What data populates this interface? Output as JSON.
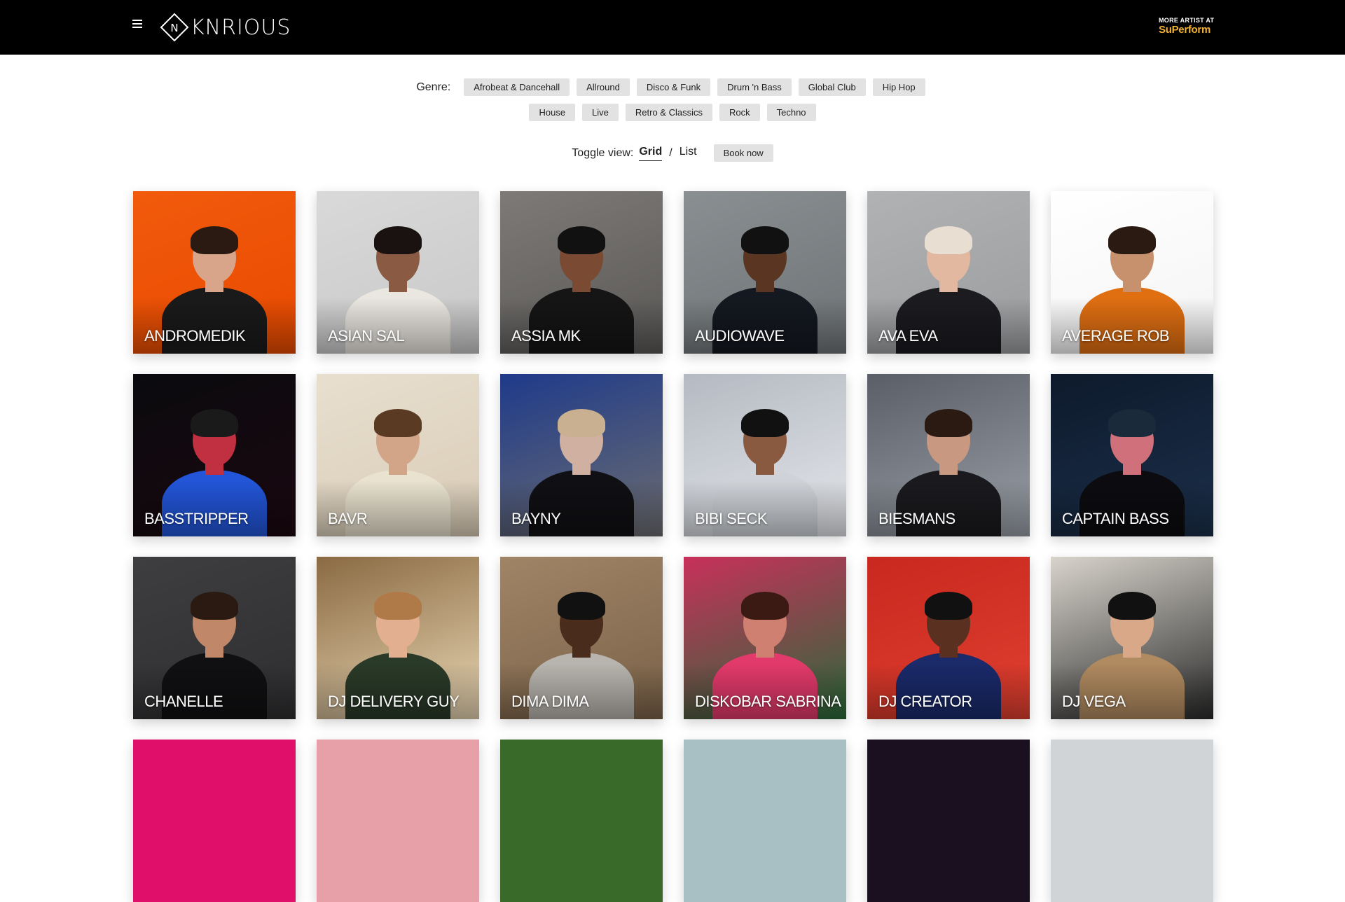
{
  "header": {
    "logo_text": "KNRIOUS",
    "promo_small": "MORE ARTIST AT",
    "promo_brand": "SuPerform"
  },
  "filters": {
    "genre_label": "Genre:",
    "genres_row1": [
      "Afrobeat & Dancehall",
      "Allround",
      "Disco & Funk",
      "Drum 'n Bass",
      "Global Club",
      "Hip Hop"
    ],
    "genres_row2": [
      "House",
      "Live",
      "Retro & Classics",
      "Rock",
      "Techno"
    ]
  },
  "view": {
    "toggle_label": "Toggle view:",
    "grid": "Grid",
    "separator": "/",
    "list": "List",
    "book_now": "Book now"
  },
  "artists": [
    {
      "name": "ANDROMEDIK",
      "bg": "#f25a0c",
      "bg2": "#e84a00",
      "skin": "#d8a58a",
      "cloth": "#1a1a1a",
      "hair": "#2a1a12"
    },
    {
      "name": "ASIAN SAL",
      "bg": "#d9d9d9",
      "bg2": "#c8c8c8",
      "skin": "#8a5a42",
      "cloth": "#eae6e0",
      "hair": "#1a1210"
    },
    {
      "name": "ASSIA MK",
      "bg": "#7d7a77",
      "bg2": "#5a5856",
      "skin": "#7a4a32",
      "cloth": "#151515",
      "hair": "#111"
    },
    {
      "name": "AUDIOWAVE",
      "bg": "#8a8f92",
      "bg2": "#6e7376",
      "skin": "#5a3622",
      "cloth": "#141820",
      "hair": "#111"
    },
    {
      "name": "AVA EVA",
      "bg": "#b0b2b4",
      "bg2": "#9a9c9e",
      "skin": "#e2b8a0",
      "cloth": "#1b1b20",
      "hair": "#e8dfd2"
    },
    {
      "name": "AVERAGE ROB",
      "bg": "#ffffff",
      "bg2": "#f4f4f4",
      "skin": "#c8916e",
      "cloth": "#e06f12",
      "hair": "#2a1a12"
    },
    {
      "name": "BASSTRIPPER",
      "bg": "#0a0a0e",
      "bg2": "#1a0810",
      "skin": "#c03040",
      "cloth": "#2255d8",
      "hair": "#1a1a1a"
    },
    {
      "name": "BAVR",
      "bg": "#e8dfcf",
      "bg2": "#d9ccb6",
      "skin": "#d2a488",
      "cloth": "#e9e2cf",
      "hair": "#5a3a22"
    },
    {
      "name": "BAYNY",
      "bg": "#1e3a8a",
      "bg2": "#6d6d70",
      "skin": "#d0b0a0",
      "cloth": "#101014",
      "hair": "#c8b090"
    },
    {
      "name": "BIBI SECK",
      "bg": "#b4bac2",
      "bg2": "#e4e6ea",
      "skin": "#8a5a40",
      "cloth": "#cfd3d8",
      "hair": "#111"
    },
    {
      "name": "BIESMANS",
      "bg": "#5a5e66",
      "bg2": "#9aa0a8",
      "skin": "#c89880",
      "cloth": "#1a1a1e",
      "hair": "#2a1a12"
    },
    {
      "name": "CAPTAIN BASS",
      "bg": "#0e1a2c",
      "bg2": "#1b2f4a",
      "skin": "#d0707a",
      "cloth": "#0c0c10",
      "hair": "#1a2a3a"
    },
    {
      "name": "CHANELLE",
      "bg": "#3e3e40",
      "bg2": "#2e2e30",
      "skin": "#c08868",
      "cloth": "#101012",
      "hair": "#2a1a12"
    },
    {
      "name": "DJ DELIVERY GUY",
      "bg": "#8a6a42",
      "bg2": "#e8d6b4",
      "skin": "#e2b090",
      "cloth": "#2a3a28",
      "hair": "#b07a48"
    },
    {
      "name": "DIMA DIMA",
      "bg": "#a08466",
      "bg2": "#7a6248",
      "skin": "#4a2c1c",
      "cloth": "#b8b4ae",
      "hair": "#111"
    },
    {
      "name": "DISKOBAR SABRINA",
      "bg": "#c8305a",
      "bg2": "#2a6a3a",
      "skin": "#d08070",
      "cloth": "#e23a6a",
      "hair": "#3a1a12"
    },
    {
      "name": "DJ CREATOR",
      "bg": "#c8281e",
      "bg2": "#e04030",
      "skin": "#5a3020",
      "cloth": "#1a2a6a",
      "hair": "#111"
    },
    {
      "name": "DJ VEGA",
      "bg": "#d8d4cc",
      "bg2": "#2a2a2a",
      "skin": "#d8a888",
      "cloth": "#b08a60",
      "hair": "#111"
    }
  ],
  "partial_row_colors": [
    "#e0106a",
    "#e8a0a8",
    "#3a6a2a",
    "#a8c0c4",
    "#1a1020",
    "#d0d4d6"
  ]
}
